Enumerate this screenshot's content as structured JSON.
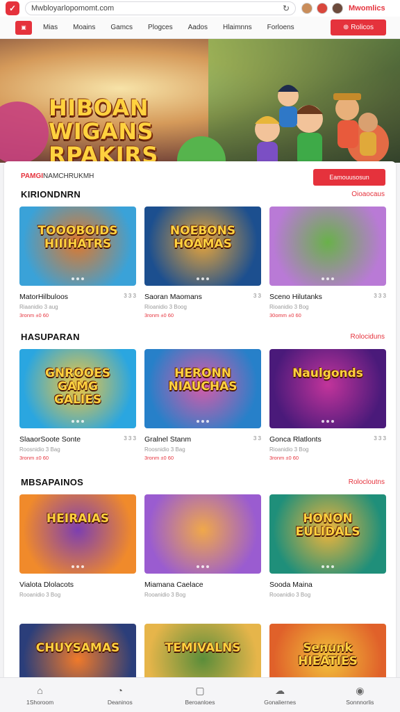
{
  "browser": {
    "url": "Mwbloyarlopomomt.com",
    "right_label": "Mwomlics"
  },
  "nav": {
    "items": [
      "Mias",
      "Moains",
      "Gamcs",
      "Plogces",
      "Aados",
      "Hlaimnns",
      "Forloens"
    ],
    "cta": "Rolicos"
  },
  "hero": {
    "title": "HIBOAN\nWIGANS\nRPAKIRS",
    "dots": 6,
    "active_dot": 0
  },
  "panel": {
    "head_accent": "PAMGI",
    "head_text": "NAMCHRUKMH",
    "button": "Eamouusosun"
  },
  "sections": [
    {
      "title": "KIRIONDNRN",
      "link": "Oioaocaus",
      "cards": [
        {
          "name": "MatorHilbuloos",
          "rating": "3 3 3",
          "sub": "Riaanidio 3 aug",
          "meta": "3ronm ±0 60",
          "thumb_title": "TOOOBOIDS\nHIIIHATRS",
          "c1": "#3aa2d8",
          "c2": "#e0772a"
        },
        {
          "name": "Saoran Maomans",
          "rating": "3 3",
          "sub": "Rioanidio 3 Boog",
          "meta": "3ronm ±0 60",
          "thumb_title": "NOEBONS\nHOAMAS",
          "c1": "#1c4f8f",
          "c2": "#e8a53a"
        },
        {
          "name": "Sceno Hilutanks",
          "rating": "3 3 3",
          "sub": "Rioanidio 3 Bog",
          "meta": "30omm ±0 60",
          "thumb_title": "",
          "c1": "#b97ad6",
          "c2": "#69b14a"
        }
      ]
    },
    {
      "title": "HASUPARAN",
      "link": "Rolociduns",
      "cards": [
        {
          "name": "SlaaorSoote Sonte",
          "rating": "3 3 3",
          "sub": "Roosnidio 3 Bag",
          "meta": "3ronm ±0 60",
          "thumb_title": "GNROOES\nGAMG\nGALIES",
          "c1": "#2aa6e0",
          "c2": "#f4c63b"
        },
        {
          "name": "Gralnel Stanm",
          "rating": "3 3",
          "sub": "Roosnidio 3 Bag",
          "meta": "3ronm ±0 60",
          "thumb_title": "HERONN\nNIAUCHAS",
          "c1": "#2780c9",
          "c2": "#d95aa8"
        },
        {
          "name": "Gonca Rlatlonts",
          "rating": "3 3 3",
          "sub": "Rioanidio 3 Bog",
          "meta": "3ronm ±0 60",
          "thumb_title": "Naulgonds",
          "c1": "#4a1a7a",
          "c2": "#c2349b"
        }
      ]
    },
    {
      "title": "MBSAPAINOS",
      "link": "Rolocloutns",
      "cards": [
        {
          "name": "Vialota Dlolacots",
          "rating": "",
          "sub": "Rooanidio 3 Bog",
          "meta": "",
          "thumb_title": "HEIRAIAS",
          "c1": "#f08a2b",
          "c2": "#7d3fb0"
        },
        {
          "name": "Miamana Caelace",
          "rating": "",
          "sub": "Rooanidio 3 Bog",
          "meta": "",
          "thumb_title": "",
          "c1": "#9a5cd0",
          "c2": "#f0a84a"
        },
        {
          "name": "Sooda Maina",
          "rating": "",
          "sub": "Rooanidio 3 Bog",
          "meta": "",
          "thumb_title": "HONON\nEULIDALS",
          "c1": "#1f8f7a",
          "c2": "#f2b53a"
        }
      ]
    },
    {
      "title": "",
      "link": "",
      "cards": [
        {
          "name": "",
          "rating": "",
          "sub": "",
          "meta": "",
          "thumb_title": "CHUYSAMAS",
          "c1": "#2b3e7a",
          "c2": "#f07a2a"
        },
        {
          "name": "",
          "rating": "",
          "sub": "",
          "meta": "",
          "thumb_title": "TEMIVALNS",
          "c1": "#e6b54a",
          "c2": "#5b8d3a"
        },
        {
          "name": "",
          "rating": "",
          "sub": "",
          "meta": "",
          "thumb_title": "Senunk\nHIEATIES",
          "c1": "#e0612a",
          "c2": "#f2c23b"
        }
      ]
    }
  ],
  "tabbar": [
    {
      "label": "1Shoroom",
      "icon": "home-icon"
    },
    {
      "label": "Deaninos",
      "icon": "games-icon"
    },
    {
      "label": "Beroanloes",
      "icon": "collection-icon"
    },
    {
      "label": "Gonaliernes",
      "icon": "chat-icon"
    },
    {
      "label": "Sonnnorlis",
      "icon": "profile-icon"
    }
  ]
}
